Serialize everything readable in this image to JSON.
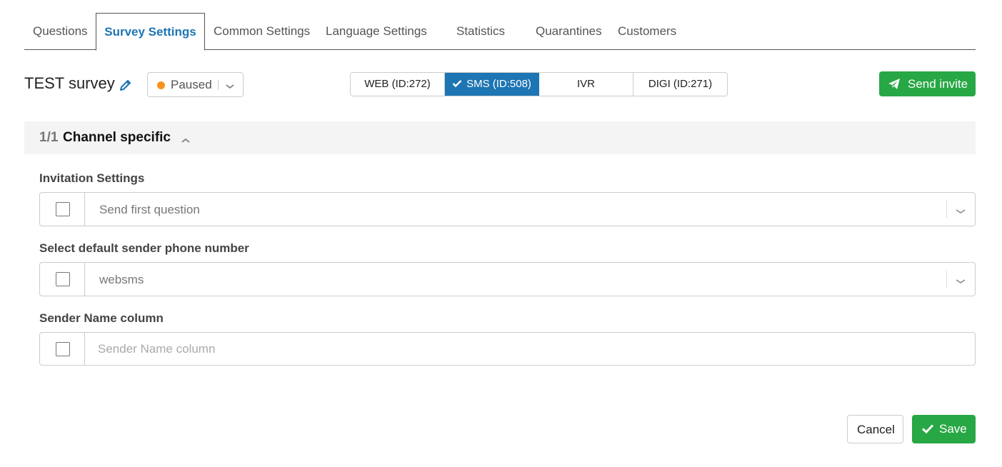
{
  "tabs": [
    {
      "label": "Questions"
    },
    {
      "label": "Survey Settings",
      "active": true
    },
    {
      "label": "Common Settings"
    },
    {
      "label": "Language Settings"
    },
    {
      "label": "Statistics"
    },
    {
      "label": "Quarantines"
    },
    {
      "label": "Customers"
    }
  ],
  "survey": {
    "title": "TEST survey",
    "status": "Paused",
    "status_color": "#f7941d"
  },
  "channels": [
    {
      "label": "WEB (ID:272)"
    },
    {
      "label": "SMS (ID:508)",
      "active": true
    },
    {
      "label": "IVR"
    },
    {
      "label": "DIGI (ID:271)"
    }
  ],
  "actions": {
    "send_invite": "Send invite",
    "cancel": "Cancel",
    "save": "Save"
  },
  "section": {
    "count": "1/1",
    "title": "Channel specific"
  },
  "fields": {
    "invitation": {
      "label": "Invitation Settings",
      "value": "Send first question"
    },
    "sender_phone": {
      "label": "Select default sender phone number",
      "value": "websms"
    },
    "sender_name": {
      "label": "Sender Name column",
      "placeholder": "Sender Name column"
    }
  },
  "colors": {
    "accent": "#1d75b3",
    "success": "#28a745"
  }
}
